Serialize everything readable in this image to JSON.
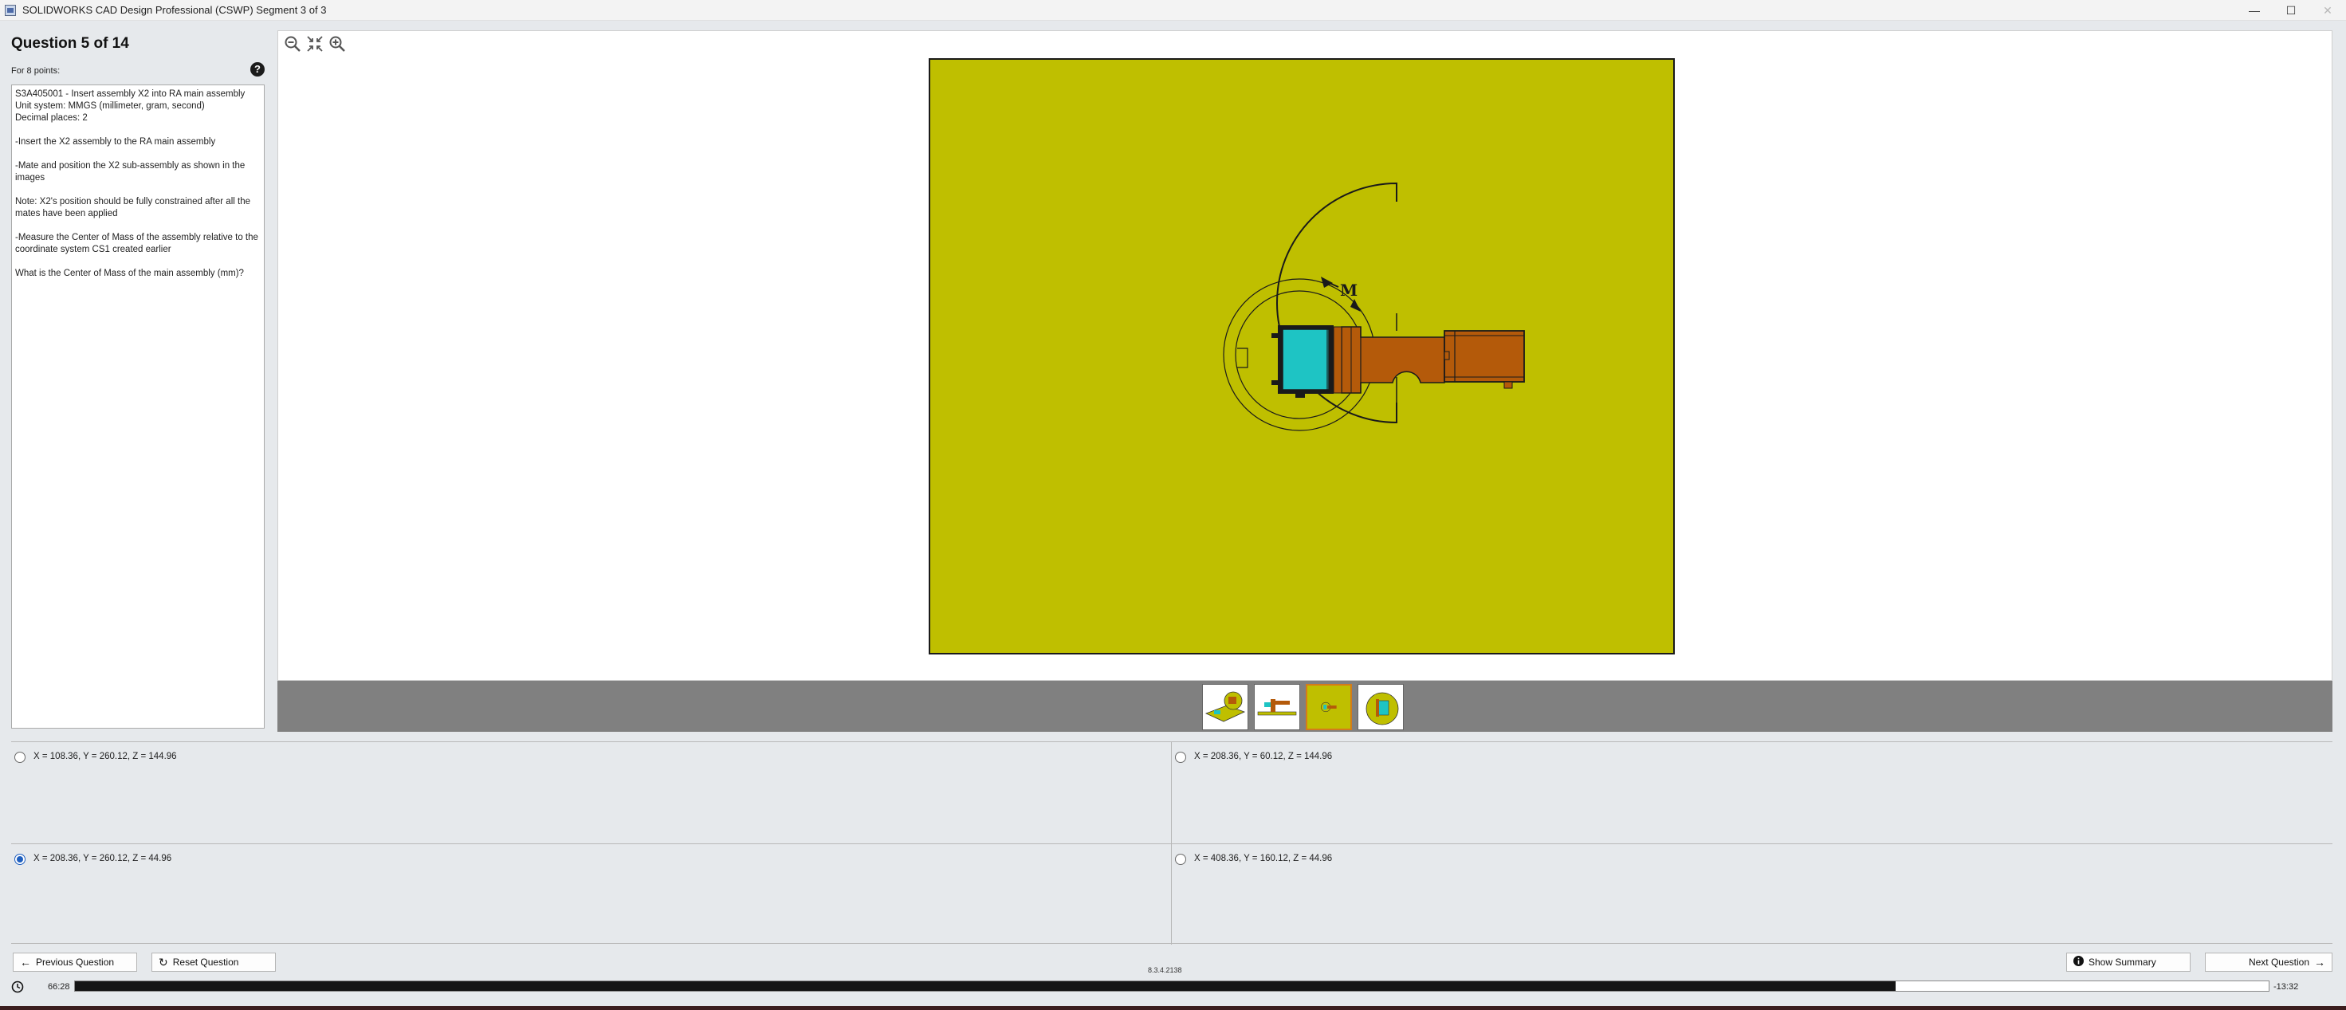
{
  "window": {
    "title": "SOLIDWORKS CAD Design Professional (CSWP) Segment 3 of 3",
    "minimize": "—",
    "maximize": "☐",
    "close": "✕"
  },
  "question": {
    "title": "Question 5 of 14",
    "points": "For 8 points:",
    "help": "?",
    "text": [
      "S3A405001 - Insert assembly X2 into RA main assembly",
      "Unit system: MMGS (millimeter, gram, second)",
      "Decimal places: 2",
      "-Insert the X2 assembly to the RA main assembly",
      "-Mate and position the X2 sub-assembly as shown in the images",
      "Note: X2's position should be fully constrained after all the mates have been applied",
      "-Measure the Center of Mass of the assembly relative to the coordinate system CS1 created earlier",
      "What is the Center of Mass of the main assembly (mm)?"
    ]
  },
  "viewer": {
    "tools": [
      "zoom-out-icon",
      "fit-icon",
      "zoom-in-icon"
    ],
    "background_color": "#bfbf00",
    "thumbnails": [
      {
        "name": "thumbnail-1",
        "selected": false
      },
      {
        "name": "thumbnail-2",
        "selected": false
      },
      {
        "name": "thumbnail-3",
        "selected": true
      },
      {
        "name": "thumbnail-4",
        "selected": false
      }
    ]
  },
  "answers": [
    {
      "label": "X = 108.36, Y = 260.12, Z = 144.96",
      "selected": false
    },
    {
      "label": "X = 208.36, Y = 60.12, Z = 144.96",
      "selected": false
    },
    {
      "label": "X = 208.36, Y = 260.12, Z = 44.96",
      "selected": true
    },
    {
      "label": "X = 408.36, Y = 160.12, Z = 44.96",
      "selected": false
    }
  ],
  "nav": {
    "previous": "Previous Question",
    "reset": "Reset Question",
    "summary": "Show Summary",
    "next": "Next Question",
    "version": "8.3.4.2138"
  },
  "timer": {
    "elapsed": "66:28",
    "remaining": "-13:32",
    "progress": 0.83
  }
}
